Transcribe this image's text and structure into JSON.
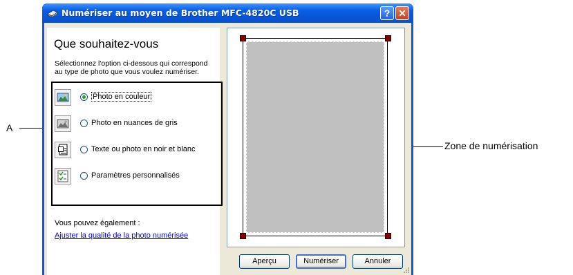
{
  "window": {
    "title": "Numériser au moyen de Brother MFC-4820C USB",
    "help_button": "?",
    "close_button": "✕"
  },
  "left_panel": {
    "heading": "Que souhaitez-vous",
    "description": "Sélectionnez l'option ci-dessous qui correspond au type de photo que vous voulez numériser.",
    "options": [
      {
        "label": "Photo en couleur",
        "selected": true,
        "icon": "color-photo-icon"
      },
      {
        "label": "Photo en nuances de gris",
        "selected": false,
        "icon": "grayscale-photo-icon"
      },
      {
        "label": "Texte ou photo en noir et blanc",
        "selected": false,
        "icon": "text-document-icon"
      },
      {
        "label": "Paramètres personnalisés",
        "selected": false,
        "icon": "custom-settings-icon"
      }
    ],
    "also_text": "Vous pouvez également :",
    "link_text": "Ajuster la qualité de la photo numérisée"
  },
  "buttons": {
    "preview": "Aperçu",
    "scan": "Numériser",
    "cancel": "Annuler"
  },
  "callouts": {
    "a_label": "A",
    "scan_zone_label": "Zone de numérisation"
  },
  "colors": {
    "titlebar": "#0a5fe6",
    "dialog_bg": "#ece9d8",
    "scan_zone": "#c0c0c0",
    "handles": "#800000",
    "radio_selected": "#21a121"
  }
}
